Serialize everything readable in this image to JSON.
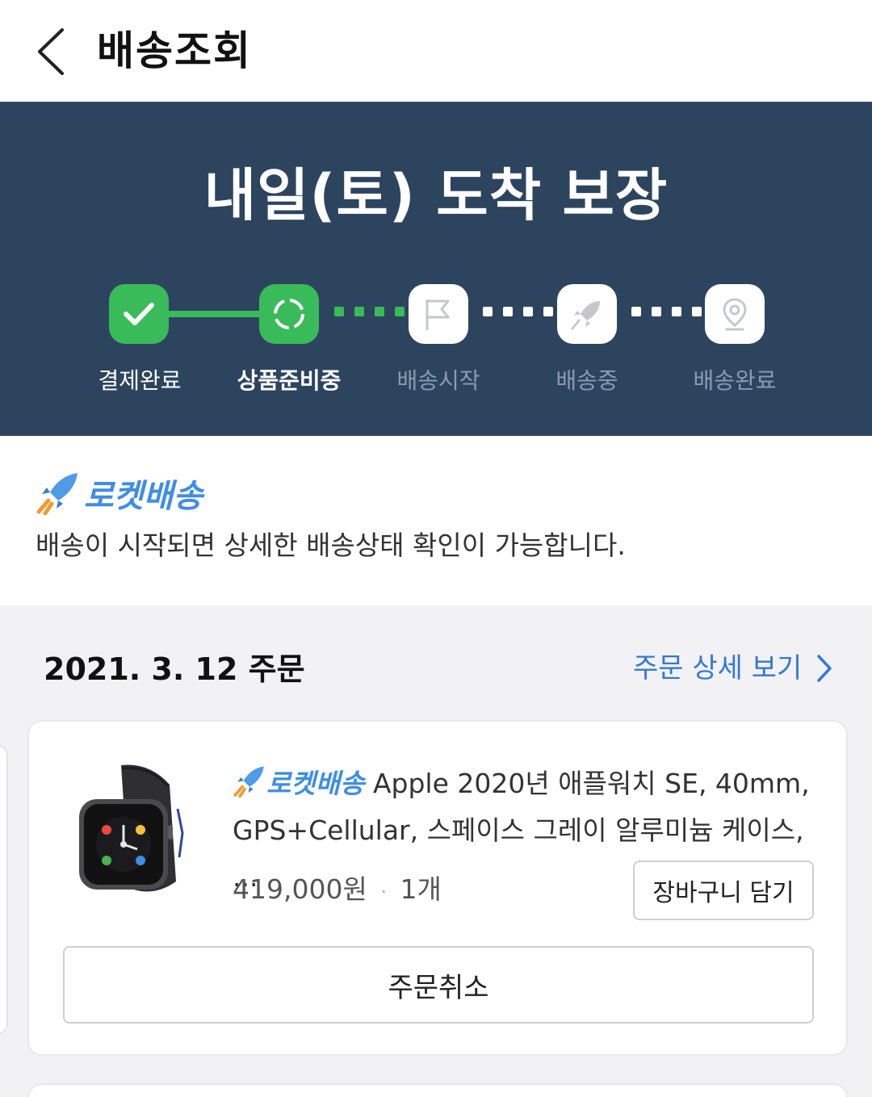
{
  "appbar": {
    "title": "배송조회"
  },
  "banner": {
    "title": "내일(토) 도착 보장",
    "steps": [
      {
        "label": "결제완료",
        "state": "done",
        "icon": "check-icon"
      },
      {
        "label": "상품준비중",
        "state": "current",
        "icon": "loading-circle-icon"
      },
      {
        "label": "배송시작",
        "state": "pending",
        "icon": "flag-icon"
      },
      {
        "label": "배송중",
        "state": "pending",
        "icon": "rocket-icon"
      },
      {
        "label": "배송완료",
        "state": "pending",
        "icon": "location-pin-icon"
      }
    ]
  },
  "info": {
    "brand": "로켓배송",
    "description": "배송이 시작되면 상세한 배송상태 확인이 가능합니다."
  },
  "order": {
    "date": "2021. 3. 12 주문",
    "detail_link": "주문 상세 보기",
    "item": {
      "badge": "로켓배송",
      "title": "Apple 2020년 애플워치 SE, 40mm, GPS+Cellular, 스페이스 그레이 알루미늄 케이스, ...",
      "price": "419,000원",
      "separator": "·",
      "quantity": "1개",
      "cart_button": "장바구니 담기",
      "cancel_button": "주문취소"
    }
  },
  "colors": {
    "banner_bg": "#2d445f",
    "progress_green": "#39bb5a",
    "link_blue": "#3478d6",
    "rocket_blue": "#3e8ee6"
  }
}
